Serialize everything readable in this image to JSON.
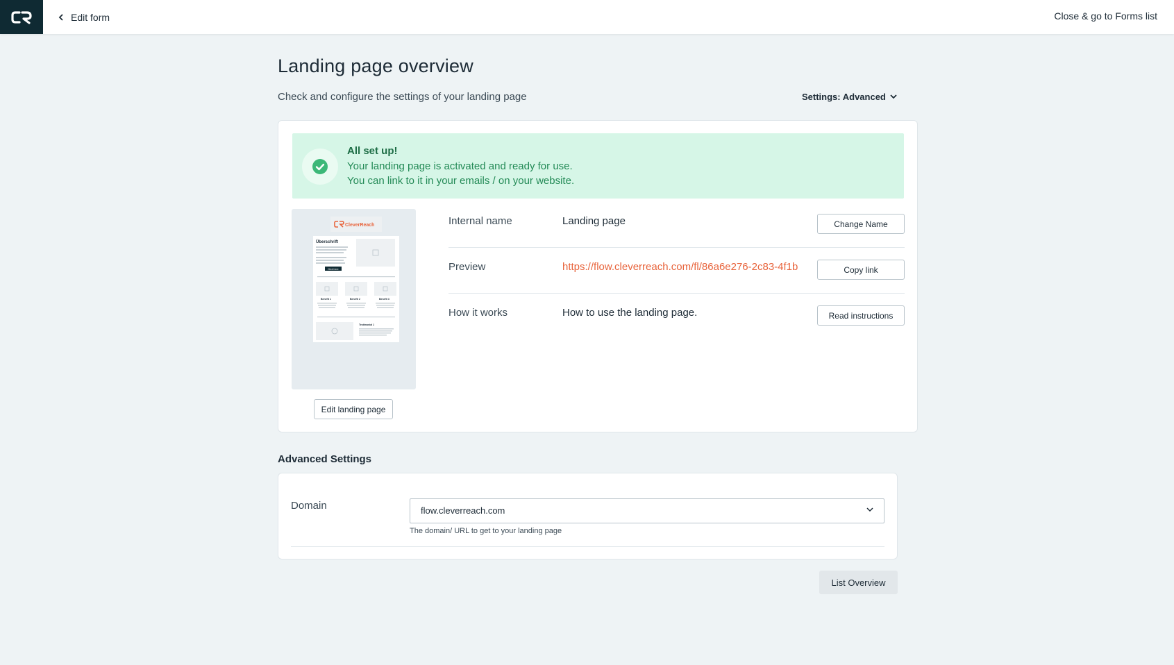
{
  "topbar": {
    "back_label": "Edit form",
    "close_label": "Close & go to Forms list"
  },
  "header": {
    "title": "Landing page overview",
    "subtitle": "Check and configure the settings of your landing page",
    "settings_toggle": "Settings: Advanced"
  },
  "banner": {
    "title": "All set up!",
    "line1": "Your landing page is activated and ready for use.",
    "line2": "You can link to it in your emails / on your website."
  },
  "thumbnail": {
    "brand": "CleverReach",
    "heading": "Überschrift",
    "button": "Click here",
    "benefit1": "Benefit 1",
    "benefit2": "Benefit 2",
    "benefit3": "Benefit 3",
    "testimonial": "Testimonial 1",
    "edit_button": "Edit landing page"
  },
  "details": [
    {
      "label": "Internal name",
      "value": "Landing page",
      "button": "Change Name"
    },
    {
      "label": "Preview",
      "value": "https://flow.cleverreach.com/fl/86a6e276-2c83-4f1b",
      "button": "Copy link"
    },
    {
      "label": "How it works",
      "value": "How to use the landing page.",
      "button": "Read instructions"
    }
  ],
  "advanced": {
    "title": "Advanced Settings",
    "domain_label": "Domain",
    "domain_value": "flow.cleverreach.com",
    "domain_help": "The domain/ URL to get to your landing page"
  },
  "footer": {
    "list_overview": "List Overview"
  },
  "colors": {
    "accent": "#e8643c",
    "success_bg": "#d6f6e7",
    "success_icon": "#3cb878",
    "logo_bg": "#0f2a33"
  }
}
